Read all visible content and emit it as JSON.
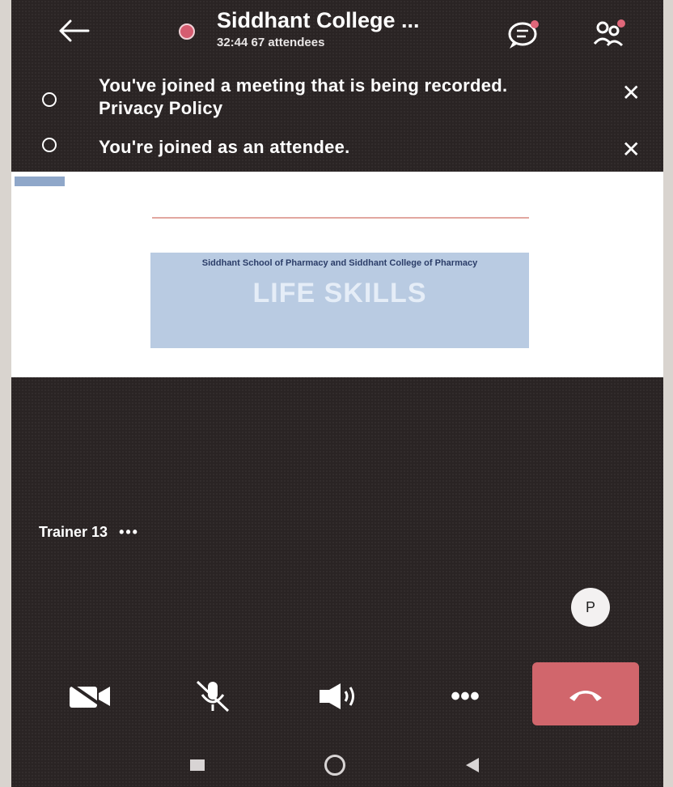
{
  "header": {
    "title": "Siddhant College ...",
    "subtitle": "32:44 67 attendees"
  },
  "banners": [
    {
      "text": "You've joined a meeting that is being recorded. Privacy Policy"
    },
    {
      "text": "You're joined as an attendee."
    }
  ],
  "slide": {
    "subtitle": "Siddhant School of Pharmacy and Siddhant College of Pharmacy",
    "title": "LIFE SKILLS"
  },
  "presenter": {
    "name": "Trainer 13",
    "dots": "•••"
  },
  "avatar": {
    "initial": "P"
  },
  "controls": {
    "more": "•••"
  },
  "colors": {
    "accent": "#d55c70",
    "hangup": "#d1666c",
    "background": "#2a2424"
  },
  "icons": [
    "back-arrow-icon",
    "record-icon",
    "chat-icon",
    "participants-icon",
    "info-icon",
    "close-icon",
    "video-off-icon",
    "mic-off-icon",
    "speaker-icon",
    "more-icon",
    "hangup-icon",
    "nav-recent-icon",
    "nav-home-icon",
    "nav-back-icon"
  ]
}
